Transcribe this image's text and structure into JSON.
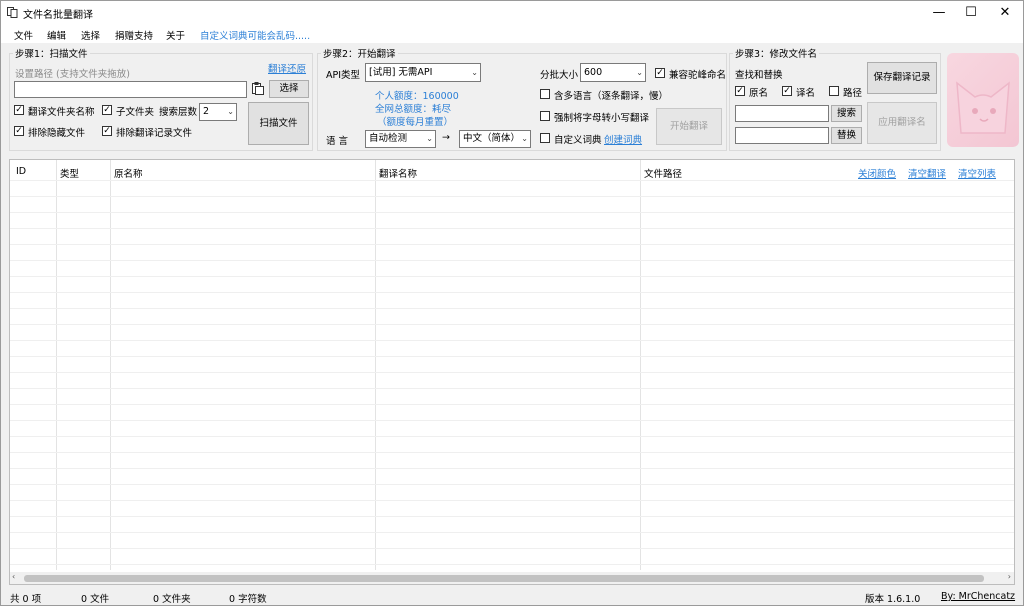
{
  "window": {
    "title": "文件名批量翻译",
    "controls": {
      "minimize": "—",
      "maximize": "☐",
      "close": "✕"
    }
  },
  "menu": {
    "items": [
      "文件",
      "编辑",
      "选择",
      "捐赠支持",
      "关于"
    ],
    "notice": "自定义词典可能会乱码....."
  },
  "step1": {
    "title": "步骤1：扫描文件",
    "path_label": "设置路径 (支持文件夹拖放)",
    "restore_link": "翻译还原",
    "path_value": "",
    "choose_button": "选择",
    "chk_translate_folder": "翻译文件夹名称",
    "chk_subfolder": "子文件夹",
    "depth_label": "搜索层数",
    "depth_value": "2",
    "chk_exclude_hidden": "排除隐藏文件",
    "chk_exclude_records": "排除翻译记录文件",
    "scan_button": "扫描文件"
  },
  "step2": {
    "title": "步骤2：开始翻译",
    "api_label": "API类型",
    "api_value": "[试用] 无需API",
    "personal_quota": "个人额度：160000",
    "global_quota": "全网总额度：耗尽",
    "quota_note": "（额度每月重置）",
    "lang_label": "语  言",
    "source_lang": "自动检测",
    "arrow": "→",
    "target_lang": "中文（简体）",
    "batch_label": "分批大小",
    "batch_value": "600",
    "chk_camel": "兼容驼峰命名",
    "chk_multilang": "含多语言（逐条翻译，慢）",
    "chk_lowercase": "强制将字母转小写翻译",
    "chk_custom_dict": "自定义词典",
    "create_dict_link": "创建词典",
    "start_button": "开始翻译"
  },
  "step3": {
    "title": "步骤3：修改文件名",
    "find_replace_label": "查找和替换",
    "chk_original": "原名",
    "chk_translated": "译名",
    "chk_path": "路径",
    "search_button": "搜索",
    "replace_button": "替换",
    "save_button": "保存翻译记录",
    "apply_button": "应用翻译名"
  },
  "table": {
    "columns": [
      "ID",
      "类型",
      "原名称",
      "翻译名称",
      "文件路径"
    ],
    "actions": [
      "关闭颜色",
      "清空翻译",
      "清空列表"
    ],
    "rows": []
  },
  "status": {
    "items_count": "共 0 项",
    "files_count": "0 文件",
    "folders_count": "0 文件夹",
    "chars_count": "0 字符数",
    "version": "版本 1.6.1.0",
    "author_link": "By: MrChencatz"
  },
  "colors": {
    "link": "#2b7fd6",
    "accent_avatar": "#f3c6d3"
  }
}
